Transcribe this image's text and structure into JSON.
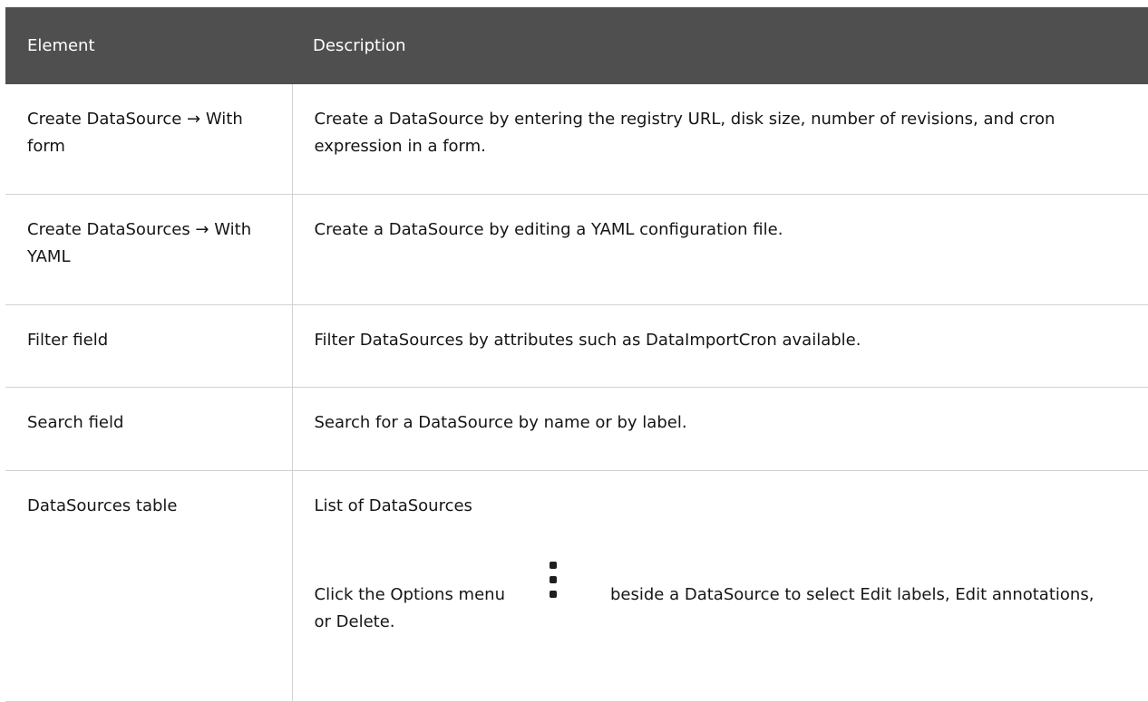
{
  "table": {
    "headers": {
      "element": "Element",
      "description": "Description"
    },
    "rows": [
      {
        "element_strong": "Create DataSource → With form",
        "element_plain": "",
        "description": "Create a DataSource by entering the registry URL, disk size, number of revisions, and cron expression in a form."
      },
      {
        "element_strong": "Create DataSources → With YAML",
        "element_plain": "",
        "description": "Create a DataSource by editing a YAML configuration file."
      },
      {
        "element_strong": "Filter",
        "element_plain": " field",
        "description": "Filter DataSources by attributes such as DataImportCron available."
      },
      {
        "element_strong": "Search",
        "element_plain": " field",
        "description": "Search for a DataSource by name or by label."
      },
      {
        "element_strong": "DataSources",
        "element_plain": " table",
        "description": "List of DataSources",
        "options": {
          "prefix": "Click the ",
          "menu_strong": "Options",
          "menu_plain": " menu",
          "icon": "kebab-icon",
          "suffix": "beside a DataSource to select ",
          "edit_labels": "Edit labels",
          "sep1": ", ",
          "edit_annotations": "Edit annotations",
          "sep2": ", or ",
          "delete": "Delete",
          "end": "."
        }
      }
    ]
  }
}
